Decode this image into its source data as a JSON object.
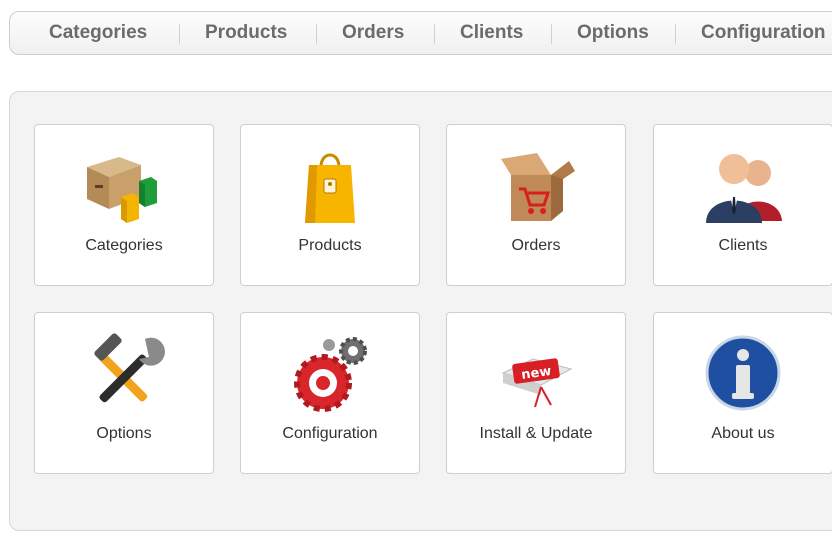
{
  "nav": {
    "items": [
      {
        "label": "Categories"
      },
      {
        "label": "Products"
      },
      {
        "label": "Orders"
      },
      {
        "label": "Clients"
      },
      {
        "label": "Options"
      },
      {
        "label": "Configuration"
      }
    ]
  },
  "dashboard": {
    "tiles": [
      {
        "label": "Categories",
        "icon": "boxes-icon"
      },
      {
        "label": "Products",
        "icon": "shopping-bag-icon"
      },
      {
        "label": "Orders",
        "icon": "cart-box-icon"
      },
      {
        "label": "Clients",
        "icon": "users-icon"
      },
      {
        "label": "Options",
        "icon": "tools-icon"
      },
      {
        "label": "Configuration",
        "icon": "gears-icon"
      },
      {
        "label": "Install & Update",
        "icon": "new-package-icon"
      },
      {
        "label": "About us",
        "icon": "info-icon"
      }
    ]
  },
  "colors": {
    "nav_text": "#6b6b6b",
    "panel_bg": "#f3f3f3",
    "tile_border": "#cfcfcf"
  }
}
